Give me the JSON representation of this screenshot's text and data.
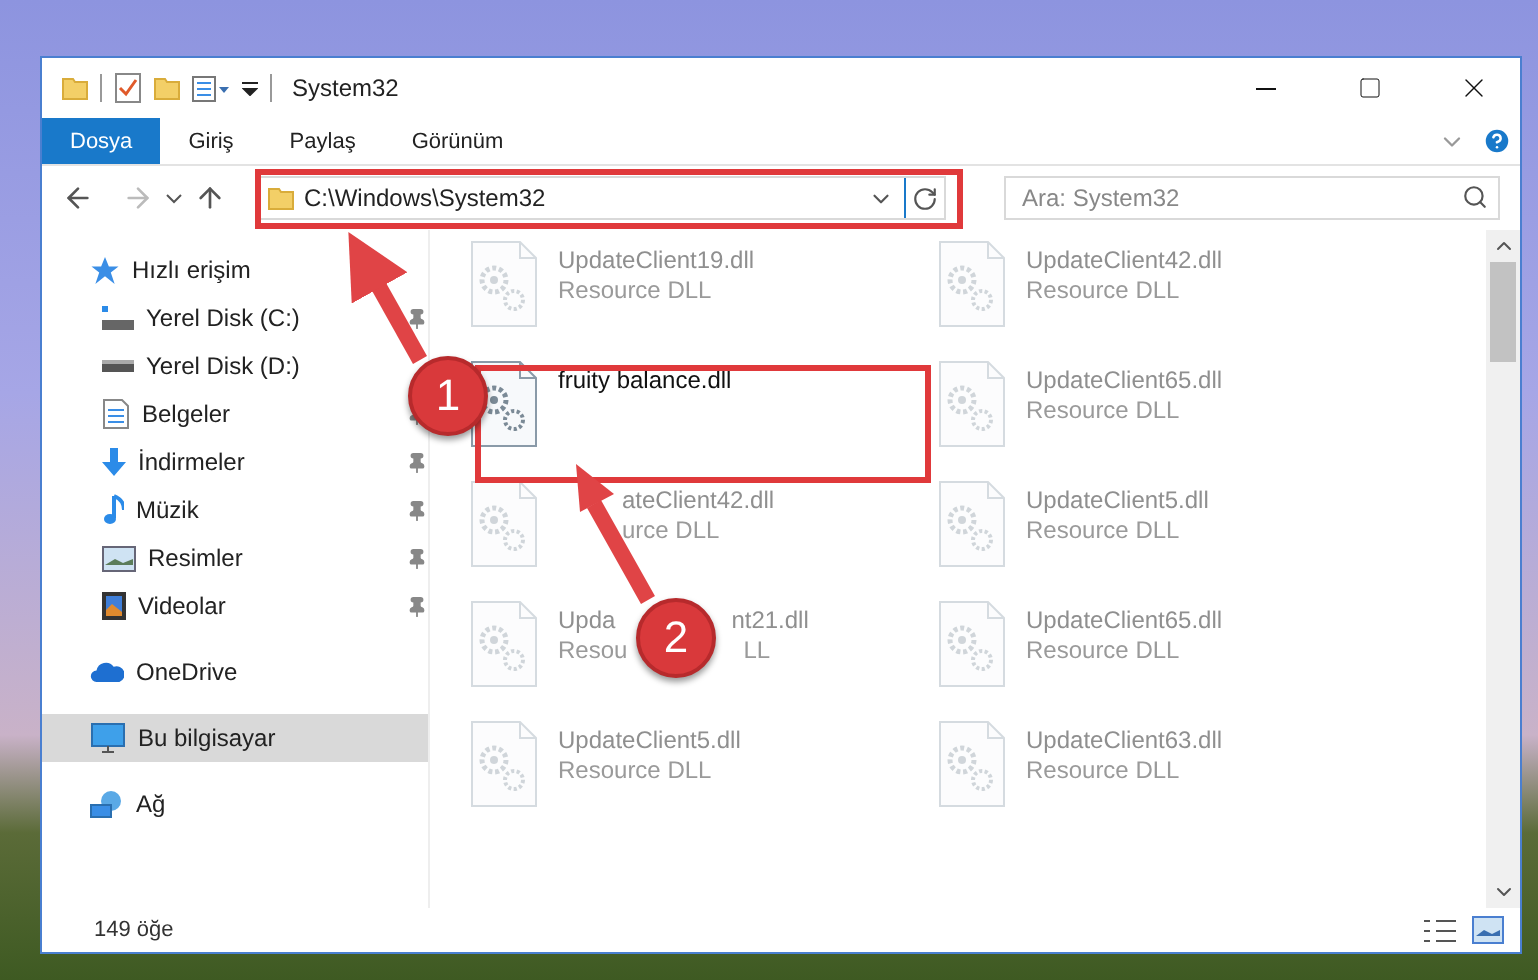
{
  "window": {
    "title": "System32"
  },
  "ribbon_tabs": [
    {
      "label": "Dosya",
      "selected": true
    },
    {
      "label": "Giriş",
      "selected": false
    },
    {
      "label": "Paylaş",
      "selected": false
    },
    {
      "label": "Görünüm",
      "selected": false
    }
  ],
  "address": {
    "path": "C:\\Windows\\System32"
  },
  "search": {
    "placeholder": "Ara: System32"
  },
  "sidebar": {
    "items": [
      {
        "label": "Hızlı erişim",
        "selected": false,
        "children": [
          {
            "label": "Yerel Disk (C:)",
            "pinned": true
          },
          {
            "label": "Yerel Disk (D:)",
            "pinned": false
          },
          {
            "label": "Belgeler",
            "pinned": true
          },
          {
            "label": "İndirmeler",
            "pinned": true
          },
          {
            "label": "Müzik",
            "pinned": true
          },
          {
            "label": "Resimler",
            "pinned": true
          },
          {
            "label": "Videolar",
            "pinned": true
          }
        ]
      },
      {
        "label": "OneDrive",
        "selected": false
      },
      {
        "label": "Bu bilgisayar",
        "selected": true
      },
      {
        "label": "Ağ",
        "selected": false
      }
    ]
  },
  "files": [
    {
      "name": [
        "UpdateClient19.dll"
      ],
      "type": [
        "Resource DLL"
      ],
      "dimmed": true
    },
    {
      "name": [
        "UpdateClient42.dll"
      ],
      "type": [
        "Resource DLL"
      ],
      "dimmed": true
    },
    {
      "name": [
        "fruity balance.dll"
      ],
      "dimmed": false
    },
    {
      "name": [
        "UpdateClient65.dll"
      ],
      "type": [
        "Resource DLL"
      ],
      "dimmed": true
    },
    {
      "name": [
        "ateClient42.dll"
      ],
      "type": [
        "urce DLL"
      ],
      "dimmed": true
    },
    {
      "name": [
        "UpdateClient5.dll"
      ],
      "type": [
        "Resource DLL"
      ],
      "dimmed": true
    },
    {
      "name": [
        "Upda",
        "nt21.dll"
      ],
      "type": [
        "Resou",
        "LL"
      ],
      "dimmed": true
    },
    {
      "name": [
        "UpdateClient65.dll"
      ],
      "type": [
        "Resource DLL"
      ],
      "dimmed": true
    },
    {
      "name": [
        "UpdateClient5.dll"
      ],
      "type": [
        "Resource DLL"
      ],
      "dimmed": true
    },
    {
      "name": [
        "UpdateClient63.dll"
      ],
      "type": [
        "Resource DLL"
      ],
      "dimmed": true
    }
  ],
  "status_bar": {
    "item_count": "149 öğe"
  },
  "annotations": [
    {
      "number": "1"
    },
    {
      "number": "2"
    }
  ]
}
